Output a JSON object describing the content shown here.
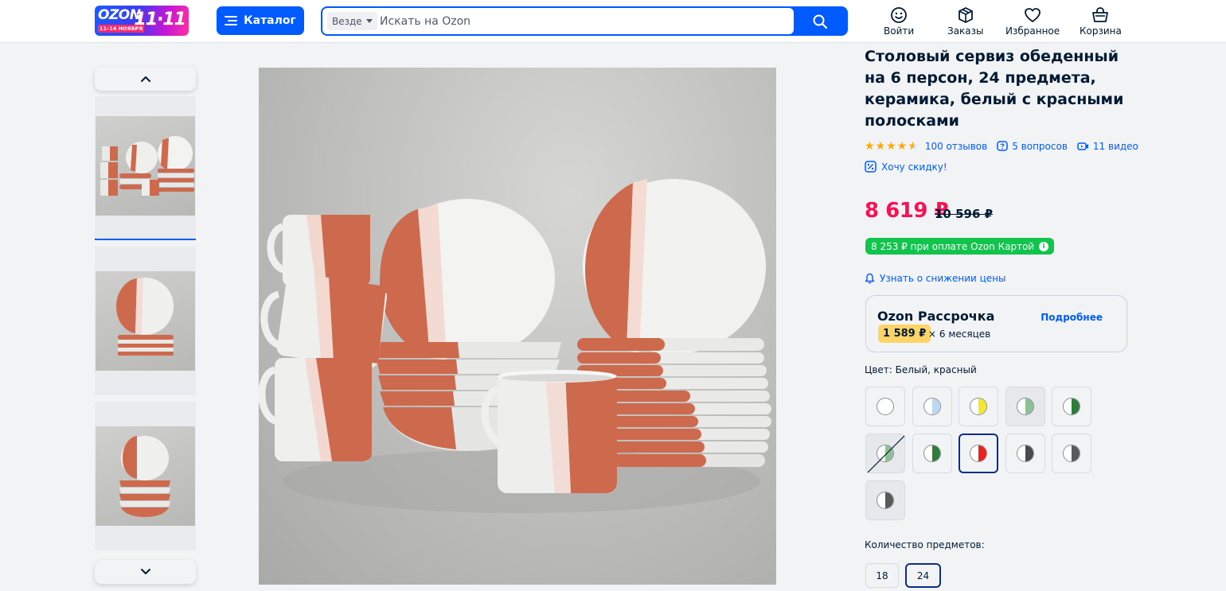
{
  "header": {
    "logo": {
      "brand": "OZON",
      "dates": "11–14 НОЯБРЯ",
      "promo": "11·11"
    },
    "catalog_label": "Каталог",
    "search": {
      "scope": "Везде",
      "placeholder": "Искать на Ozon"
    },
    "actions": [
      {
        "label": "Войти",
        "icon": "smile-icon"
      },
      {
        "label": "Заказы",
        "icon": "box-icon"
      },
      {
        "label": "Избранное",
        "icon": "heart-icon"
      },
      {
        "label": "Корзина",
        "icon": "basket-icon"
      }
    ]
  },
  "product": {
    "title": "Столовый сервиз обеденный на 6 персон, 24 предмета, керамика, белый с красными полосками",
    "rating": 4.5,
    "reviews": "100 отзывов",
    "questions": "5 вопросов",
    "videos": "11 видео",
    "discount_link": "Хочу скидку!",
    "price": "8 619 ₽",
    "old_price": "10 596 ₽",
    "card_price": "8 253 ₽ при оплате Ozon Картой",
    "notify": "Узнать о снижении цены",
    "installment": {
      "name": "Ozon Рассрочка",
      "amount": "1 589 ₽",
      "months": "× 6 месяцев",
      "more": "Подробнее"
    },
    "color_label": "Цвет: Белый, красный",
    "colors": [
      {
        "accent": "#ffffff"
      },
      {
        "accent": "#bcd9f2"
      },
      {
        "accent": "#f2e832"
      },
      {
        "accent": "#8fbf94"
      },
      {
        "accent": "#2e7d3a"
      },
      {
        "accent": "#8fbf94"
      },
      {
        "accent": "#2e7d3a"
      },
      {
        "accent": "#e8231b"
      },
      {
        "accent": "#4a4a4a"
      },
      {
        "accent": "#5a5a5a"
      },
      {
        "accent": "#5a5a5a"
      }
    ],
    "quantity_label": "Количество предметов:",
    "quantities": [
      "18",
      "24"
    ]
  },
  "colors": {
    "accent": "#005bff",
    "price": "#f91155",
    "card_badge": "#10c44c",
    "selected_border": "#0a2d8a",
    "terracotta": "#cd6a4e"
  }
}
